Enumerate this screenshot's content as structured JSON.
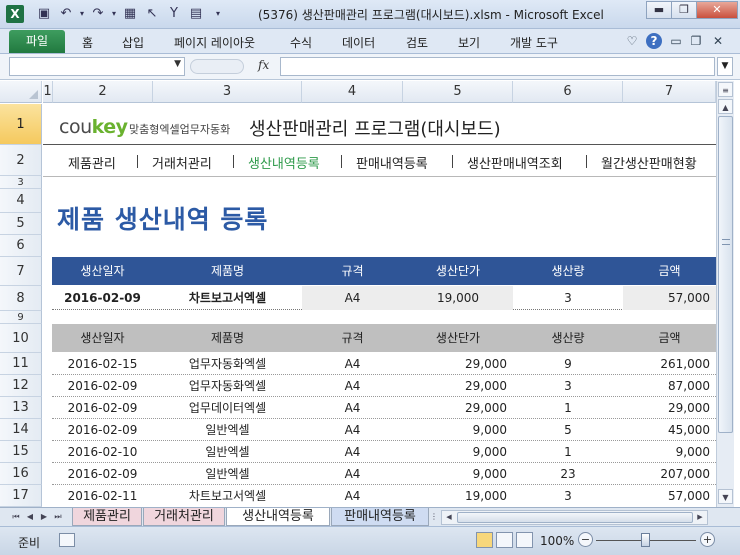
{
  "window": {
    "title": "(5376) 생산판매관리 프로그램(대시보드).xlsm  -  Microsoft Excel",
    "app_icon_letter": "X",
    "quick_access": [
      "save-icon",
      "undo-icon",
      "redo-icon",
      "camera-icon",
      "select-icon",
      "filter-icon",
      "form-icon",
      "customize-icon"
    ]
  },
  "ribbon": {
    "file_tab": "파일",
    "tabs": [
      "홈",
      "삽입",
      "페이지 레이아웃",
      "수식",
      "데이터",
      "검토",
      "보기",
      "개발 도구"
    ]
  },
  "formula_bar": {
    "name_box": "",
    "fx_label": "fx",
    "formula": ""
  },
  "columns": [
    "1",
    "2",
    "3",
    "4",
    "5",
    "6",
    "7"
  ],
  "rows": [
    "1",
    "2",
    "3",
    "4",
    "5",
    "6",
    "7",
    "8",
    "9",
    "10",
    "11",
    "12",
    "13",
    "14",
    "15",
    "16",
    "17"
  ],
  "header": {
    "logo_prefix": "cou",
    "logo_key": "key",
    "tagline": "맞춤형엑셀업무자동화",
    "program_title": "생산판매관리 프로그램(대시보드)"
  },
  "nav": {
    "items": [
      "제품관리",
      "거래처관리",
      "생산내역등록",
      "판매내역등록",
      "생산판매내역조회",
      "월간생산판매현황"
    ],
    "active_index": 2,
    "active_color": "#2e9a4a"
  },
  "page_title": "제품 생산내역 등록",
  "entry_form": {
    "headers": [
      "생산일자",
      "제품명",
      "규격",
      "생산단가",
      "생산량",
      "금액"
    ],
    "row": [
      "2016-02-09",
      "차트보고서엑셀",
      "A4",
      "19,000",
      "3",
      "57,000"
    ],
    "header_color": "#2f5597"
  },
  "list": {
    "headers": [
      "생산일자",
      "제품명",
      "규격",
      "생산단가",
      "생산량",
      "금액"
    ],
    "rows": [
      [
        "2016-02-15",
        "업무자동화엑셀",
        "A4",
        "29,000",
        "9",
        "261,000"
      ],
      [
        "2016-02-09",
        "업무자동화엑셀",
        "A4",
        "29,000",
        "3",
        "87,000"
      ],
      [
        "2016-02-09",
        "업무데이터엑셀",
        "A4",
        "29,000",
        "1",
        "29,000"
      ],
      [
        "2016-02-09",
        "일반엑셀",
        "A4",
        "9,000",
        "5",
        "45,000"
      ],
      [
        "2016-02-10",
        "일반엑셀",
        "A4",
        "9,000",
        "1",
        "9,000"
      ],
      [
        "2016-02-09",
        "일반엑셀",
        "A4",
        "9,000",
        "23",
        "207,000"
      ],
      [
        "2016-02-11",
        "차트보고서엑셀",
        "A4",
        "19,000",
        "3",
        "57,000"
      ]
    ]
  },
  "sheet_tabs": [
    "제품관리",
    "거래처관리",
    "생산내역등록",
    "판매내역등록"
  ],
  "active_sheet": "생산내역등록",
  "status": {
    "ready": "준비",
    "zoom": "100%"
  }
}
